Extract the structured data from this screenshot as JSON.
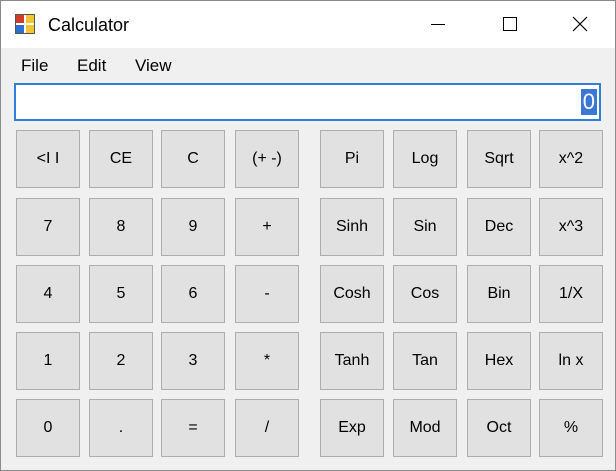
{
  "window": {
    "title": "Calculator",
    "icon": "calculator-app-icon"
  },
  "caption_buttons": {
    "minimize": "minimize-icon",
    "maximize": "maximize-icon",
    "close": "close-icon"
  },
  "menu": {
    "file": "File",
    "edit": "Edit",
    "view": "View"
  },
  "display": {
    "value": "0"
  },
  "keys": [
    [
      "<I I",
      "CE",
      "C",
      "(+ -)",
      "Pi",
      "Log",
      "Sqrt",
      "x^2"
    ],
    [
      "7",
      "8",
      "9",
      "+",
      "Sinh",
      "Sin",
      "Dec",
      "x^3"
    ],
    [
      "4",
      "5",
      "6",
      "-",
      "Cosh",
      "Cos",
      "Bin",
      "1/X"
    ],
    [
      "1",
      "2",
      "3",
      "*",
      "Tanh",
      "Tan",
      "Hex",
      "ln x"
    ],
    [
      "0",
      ".",
      "=",
      "/",
      "Exp",
      "Mod",
      "Oct",
      "%"
    ]
  ],
  "colors": {
    "selection": "#3b78d6",
    "display_border": "#2f7ed8",
    "key_face": "#e1e1e1"
  }
}
